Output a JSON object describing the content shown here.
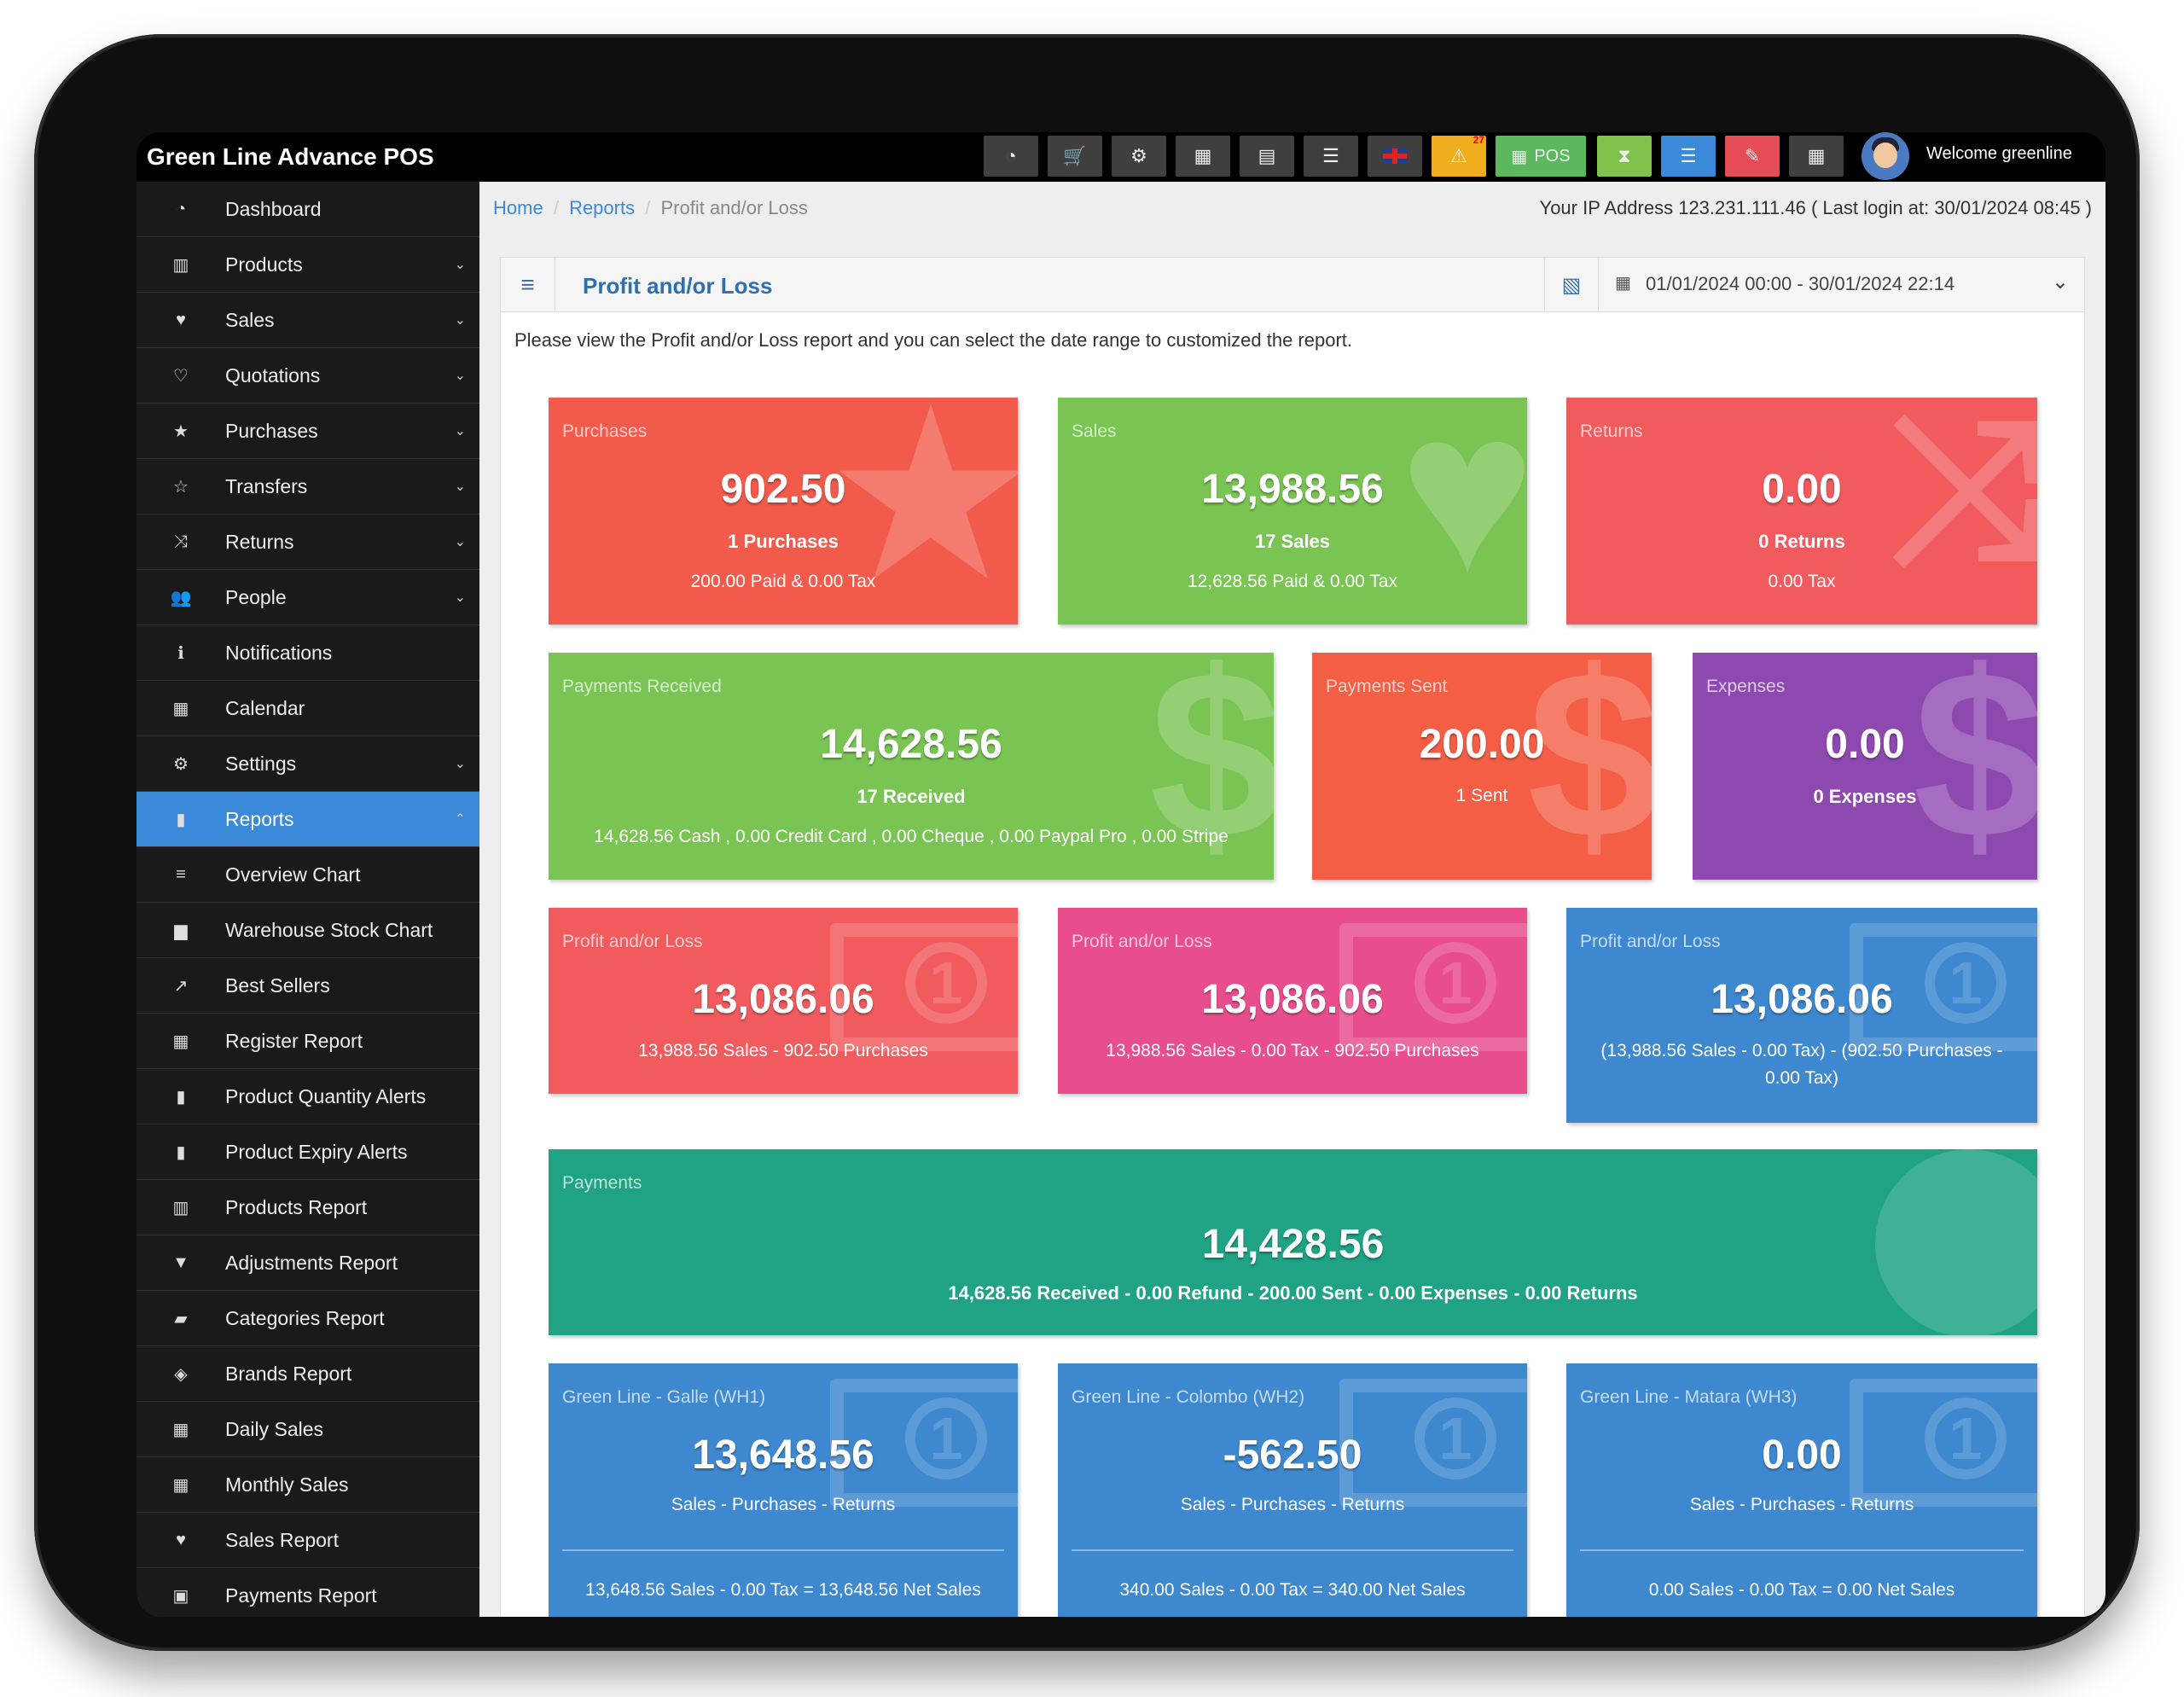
{
  "app": {
    "title": "Green Line Advance POS",
    "welcome": "Welcome greenline"
  },
  "toolbar": {
    "pos_label": "POS",
    "alert_count": "27"
  },
  "sidebar": {
    "items": [
      {
        "label": "Dashboard",
        "icon": "dashboard-icon",
        "glyph": "◔",
        "arrow": ""
      },
      {
        "label": "Products",
        "icon": "barcode-icon",
        "glyph": "▥",
        "arrow": "⌄"
      },
      {
        "label": "Sales",
        "icon": "heart-icon",
        "glyph": "♥",
        "arrow": "⌄"
      },
      {
        "label": "Quotations",
        "icon": "heart-outline-icon",
        "glyph": "♡",
        "arrow": "⌄"
      },
      {
        "label": "Purchases",
        "icon": "star-icon",
        "glyph": "★",
        "arrow": "⌄"
      },
      {
        "label": "Transfers",
        "icon": "star-outline-icon",
        "glyph": "☆",
        "arrow": "⌄"
      },
      {
        "label": "Returns",
        "icon": "shuffle-icon",
        "glyph": "⤨",
        "arrow": "⌄"
      },
      {
        "label": "People",
        "icon": "users-icon",
        "glyph": "👥",
        "arrow": "⌄"
      },
      {
        "label": "Notifications",
        "icon": "info-icon",
        "glyph": "ℹ",
        "arrow": ""
      },
      {
        "label": "Calendar",
        "icon": "calendar-icon",
        "glyph": "▦",
        "arrow": ""
      },
      {
        "label": "Settings",
        "icon": "gear-icon",
        "glyph": "⚙",
        "arrow": "⌄"
      },
      {
        "label": "Reports",
        "icon": "bar-chart-icon",
        "glyph": "▮",
        "arrow": "⌃",
        "active": true
      },
      {
        "label": "Overview Chart",
        "icon": "list-icon",
        "glyph": "≡",
        "arrow": ""
      },
      {
        "label": "Warehouse Stock Chart",
        "icon": "building-icon",
        "glyph": "▆",
        "arrow": ""
      },
      {
        "label": "Best Sellers",
        "icon": "line-chart-icon",
        "glyph": "↗",
        "arrow": ""
      },
      {
        "label": "Register Report",
        "icon": "grid-icon",
        "glyph": "▦",
        "arrow": ""
      },
      {
        "label": "Product Quantity Alerts",
        "icon": "bar-chart-icon",
        "glyph": "▮",
        "arrow": ""
      },
      {
        "label": "Product Expiry Alerts",
        "icon": "bar-chart-icon",
        "glyph": "▮",
        "arrow": ""
      },
      {
        "label": "Products Report",
        "icon": "barcode-icon",
        "glyph": "▥",
        "arrow": ""
      },
      {
        "label": "Adjustments Report",
        "icon": "filter-icon",
        "glyph": "▼",
        "arrow": ""
      },
      {
        "label": "Categories Report",
        "icon": "folder-icon",
        "glyph": "▰",
        "arrow": ""
      },
      {
        "label": "Brands Report",
        "icon": "cubes-icon",
        "glyph": "◈",
        "arrow": ""
      },
      {
        "label": "Daily Sales",
        "icon": "calendar-icon",
        "glyph": "▦",
        "arrow": ""
      },
      {
        "label": "Monthly Sales",
        "icon": "calendar-icon",
        "glyph": "▦",
        "arrow": ""
      },
      {
        "label": "Sales Report",
        "icon": "heart-icon",
        "glyph": "♥",
        "arrow": ""
      },
      {
        "label": "Payments Report",
        "icon": "money-icon",
        "glyph": "▣",
        "arrow": ""
      }
    ]
  },
  "breadcrumb": {
    "home": "Home",
    "reports": "Reports",
    "current": "Profit and/or Loss",
    "sep": "/"
  },
  "ip_info": "Your IP Address 123.231.111.46 ( Last login at: 30/01/2024 08:45 )",
  "panel": {
    "title": "Profit and/or Loss",
    "date_range": "01/01/2024 00:00 - 30/01/2024 22:14",
    "intro": "Please view the Profit and/or Loss report and you can select the date range to customized the report."
  },
  "cards": {
    "purchases": {
      "label": "Purchases",
      "value": "902.50",
      "line1": "1 Purchases",
      "line2": "200.00 Paid & 0.00 Tax"
    },
    "sales": {
      "label": "Sales",
      "value": "13,988.56",
      "line1": "17 Sales",
      "line2": "12,628.56 Paid & 0.00 Tax"
    },
    "returns": {
      "label": "Returns",
      "value": "0.00",
      "line1": "0 Returns",
      "line2": "0.00 Tax"
    },
    "payments_received": {
      "label": "Payments Received",
      "value": "14,628.56",
      "line1": "17 Received",
      "line2": "14,628.56 Cash , 0.00 Credit Card , 0.00 Cheque , 0.00 Paypal Pro , 0.00 Stripe"
    },
    "payments_sent": {
      "label": "Payments Sent",
      "value": "200.00",
      "line2": "1 Sent"
    },
    "expenses": {
      "label": "Expenses",
      "value": "0.00",
      "line1": "0 Expenses"
    },
    "pl1": {
      "label": "Profit and/or Loss",
      "value": "13,086.06",
      "line2": "13,988.56 Sales - 902.50 Purchases"
    },
    "pl2": {
      "label": "Profit and/or Loss",
      "value": "13,086.06",
      "line2": "13,988.56 Sales - 0.00 Tax - 902.50 Purchases"
    },
    "pl3": {
      "label": "Profit and/or Loss",
      "value": "13,086.06",
      "line2a": "(13,988.56 Sales - 0.00 Tax) - (902.50 Purchases -",
      "line2b": "0.00 Tax)"
    },
    "payments": {
      "label": "Payments",
      "value": "14,428.56",
      "line1": "14,628.56 Received - 0.00 Refund - 200.00 Sent - 0.00 Expenses - 0.00 Returns"
    },
    "wh1": {
      "label": "Green Line - Galle (WH1)",
      "value": "13,648.56",
      "line2": "Sales - Purchases - Returns",
      "line3": "13,648.56 Sales - 0.00 Tax = 13,648.56 Net Sales"
    },
    "wh2": {
      "label": "Green Line - Colombo (WH2)",
      "value": "-562.50",
      "line2": "Sales - Purchases - Returns",
      "line3": "340.00 Sales - 0.00 Tax = 340.00 Net Sales"
    },
    "wh3": {
      "label": "Green Line - Matara (WH3)",
      "value": "0.00",
      "line2": "Sales - Purchases - Returns",
      "line3": "0.00 Sales - 0.00 Tax = 0.00 Net Sales"
    }
  },
  "colors": {
    "sidebar_active": "#3b8ad9",
    "link": "#3b8ad9"
  }
}
